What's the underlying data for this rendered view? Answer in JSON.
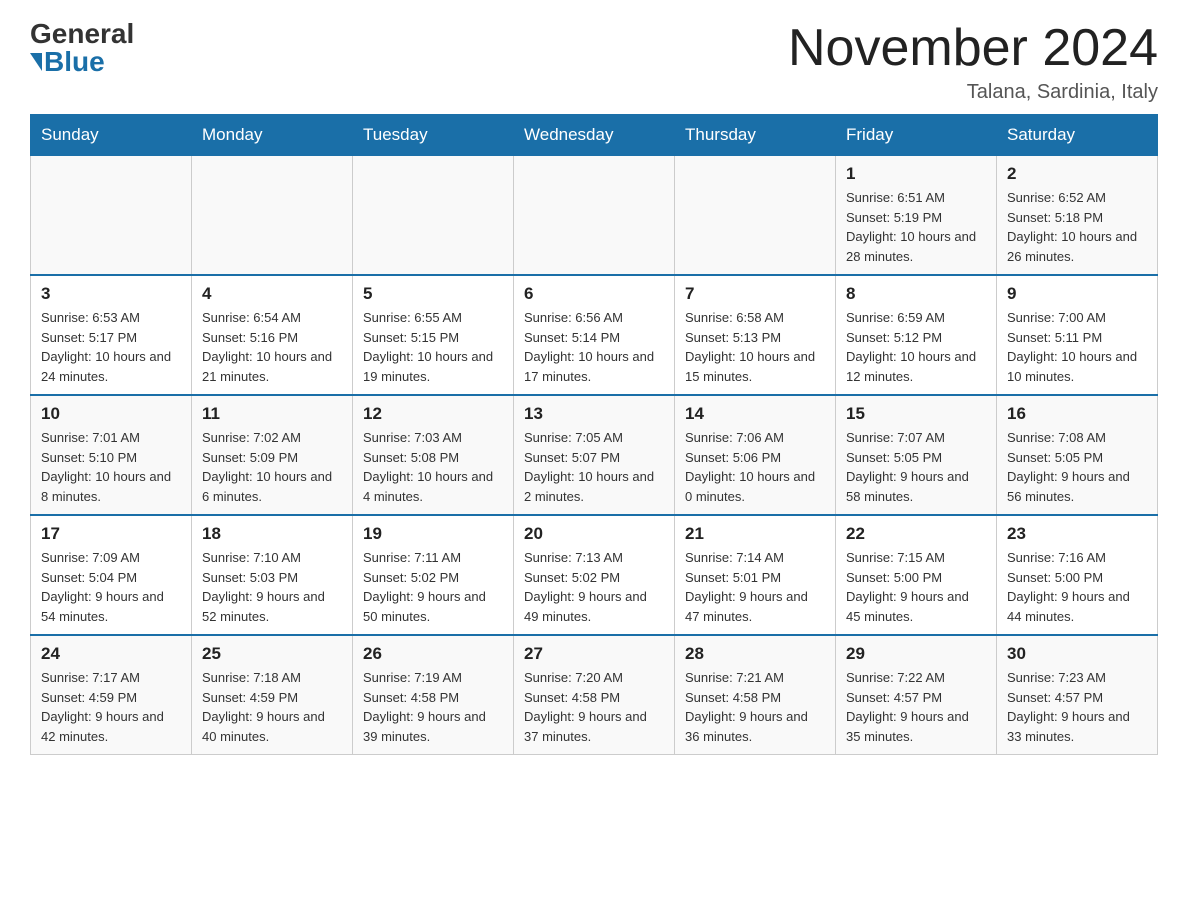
{
  "header": {
    "logo_general": "General",
    "logo_blue": "Blue",
    "month_title": "November 2024",
    "location": "Talana, Sardinia, Italy"
  },
  "days_of_week": [
    "Sunday",
    "Monday",
    "Tuesday",
    "Wednesday",
    "Thursday",
    "Friday",
    "Saturday"
  ],
  "weeks": [
    [
      {
        "day": "",
        "sunrise": "",
        "sunset": "",
        "daylight": ""
      },
      {
        "day": "",
        "sunrise": "",
        "sunset": "",
        "daylight": ""
      },
      {
        "day": "",
        "sunrise": "",
        "sunset": "",
        "daylight": ""
      },
      {
        "day": "",
        "sunrise": "",
        "sunset": "",
        "daylight": ""
      },
      {
        "day": "",
        "sunrise": "",
        "sunset": "",
        "daylight": ""
      },
      {
        "day": "1",
        "sunrise": "Sunrise: 6:51 AM",
        "sunset": "Sunset: 5:19 PM",
        "daylight": "Daylight: 10 hours and 28 minutes."
      },
      {
        "day": "2",
        "sunrise": "Sunrise: 6:52 AM",
        "sunset": "Sunset: 5:18 PM",
        "daylight": "Daylight: 10 hours and 26 minutes."
      }
    ],
    [
      {
        "day": "3",
        "sunrise": "Sunrise: 6:53 AM",
        "sunset": "Sunset: 5:17 PM",
        "daylight": "Daylight: 10 hours and 24 minutes."
      },
      {
        "day": "4",
        "sunrise": "Sunrise: 6:54 AM",
        "sunset": "Sunset: 5:16 PM",
        "daylight": "Daylight: 10 hours and 21 minutes."
      },
      {
        "day": "5",
        "sunrise": "Sunrise: 6:55 AM",
        "sunset": "Sunset: 5:15 PM",
        "daylight": "Daylight: 10 hours and 19 minutes."
      },
      {
        "day": "6",
        "sunrise": "Sunrise: 6:56 AM",
        "sunset": "Sunset: 5:14 PM",
        "daylight": "Daylight: 10 hours and 17 minutes."
      },
      {
        "day": "7",
        "sunrise": "Sunrise: 6:58 AM",
        "sunset": "Sunset: 5:13 PM",
        "daylight": "Daylight: 10 hours and 15 minutes."
      },
      {
        "day": "8",
        "sunrise": "Sunrise: 6:59 AM",
        "sunset": "Sunset: 5:12 PM",
        "daylight": "Daylight: 10 hours and 12 minutes."
      },
      {
        "day": "9",
        "sunrise": "Sunrise: 7:00 AM",
        "sunset": "Sunset: 5:11 PM",
        "daylight": "Daylight: 10 hours and 10 minutes."
      }
    ],
    [
      {
        "day": "10",
        "sunrise": "Sunrise: 7:01 AM",
        "sunset": "Sunset: 5:10 PM",
        "daylight": "Daylight: 10 hours and 8 minutes."
      },
      {
        "day": "11",
        "sunrise": "Sunrise: 7:02 AM",
        "sunset": "Sunset: 5:09 PM",
        "daylight": "Daylight: 10 hours and 6 minutes."
      },
      {
        "day": "12",
        "sunrise": "Sunrise: 7:03 AM",
        "sunset": "Sunset: 5:08 PM",
        "daylight": "Daylight: 10 hours and 4 minutes."
      },
      {
        "day": "13",
        "sunrise": "Sunrise: 7:05 AM",
        "sunset": "Sunset: 5:07 PM",
        "daylight": "Daylight: 10 hours and 2 minutes."
      },
      {
        "day": "14",
        "sunrise": "Sunrise: 7:06 AM",
        "sunset": "Sunset: 5:06 PM",
        "daylight": "Daylight: 10 hours and 0 minutes."
      },
      {
        "day": "15",
        "sunrise": "Sunrise: 7:07 AM",
        "sunset": "Sunset: 5:05 PM",
        "daylight": "Daylight: 9 hours and 58 minutes."
      },
      {
        "day": "16",
        "sunrise": "Sunrise: 7:08 AM",
        "sunset": "Sunset: 5:05 PM",
        "daylight": "Daylight: 9 hours and 56 minutes."
      }
    ],
    [
      {
        "day": "17",
        "sunrise": "Sunrise: 7:09 AM",
        "sunset": "Sunset: 5:04 PM",
        "daylight": "Daylight: 9 hours and 54 minutes."
      },
      {
        "day": "18",
        "sunrise": "Sunrise: 7:10 AM",
        "sunset": "Sunset: 5:03 PM",
        "daylight": "Daylight: 9 hours and 52 minutes."
      },
      {
        "day": "19",
        "sunrise": "Sunrise: 7:11 AM",
        "sunset": "Sunset: 5:02 PM",
        "daylight": "Daylight: 9 hours and 50 minutes."
      },
      {
        "day": "20",
        "sunrise": "Sunrise: 7:13 AM",
        "sunset": "Sunset: 5:02 PM",
        "daylight": "Daylight: 9 hours and 49 minutes."
      },
      {
        "day": "21",
        "sunrise": "Sunrise: 7:14 AM",
        "sunset": "Sunset: 5:01 PM",
        "daylight": "Daylight: 9 hours and 47 minutes."
      },
      {
        "day": "22",
        "sunrise": "Sunrise: 7:15 AM",
        "sunset": "Sunset: 5:00 PM",
        "daylight": "Daylight: 9 hours and 45 minutes."
      },
      {
        "day": "23",
        "sunrise": "Sunrise: 7:16 AM",
        "sunset": "Sunset: 5:00 PM",
        "daylight": "Daylight: 9 hours and 44 minutes."
      }
    ],
    [
      {
        "day": "24",
        "sunrise": "Sunrise: 7:17 AM",
        "sunset": "Sunset: 4:59 PM",
        "daylight": "Daylight: 9 hours and 42 minutes."
      },
      {
        "day": "25",
        "sunrise": "Sunrise: 7:18 AM",
        "sunset": "Sunset: 4:59 PM",
        "daylight": "Daylight: 9 hours and 40 minutes."
      },
      {
        "day": "26",
        "sunrise": "Sunrise: 7:19 AM",
        "sunset": "Sunset: 4:58 PM",
        "daylight": "Daylight: 9 hours and 39 minutes."
      },
      {
        "day": "27",
        "sunrise": "Sunrise: 7:20 AM",
        "sunset": "Sunset: 4:58 PM",
        "daylight": "Daylight: 9 hours and 37 minutes."
      },
      {
        "day": "28",
        "sunrise": "Sunrise: 7:21 AM",
        "sunset": "Sunset: 4:58 PM",
        "daylight": "Daylight: 9 hours and 36 minutes."
      },
      {
        "day": "29",
        "sunrise": "Sunrise: 7:22 AM",
        "sunset": "Sunset: 4:57 PM",
        "daylight": "Daylight: 9 hours and 35 minutes."
      },
      {
        "day": "30",
        "sunrise": "Sunrise: 7:23 AM",
        "sunset": "Sunset: 4:57 PM",
        "daylight": "Daylight: 9 hours and 33 minutes."
      }
    ]
  ]
}
